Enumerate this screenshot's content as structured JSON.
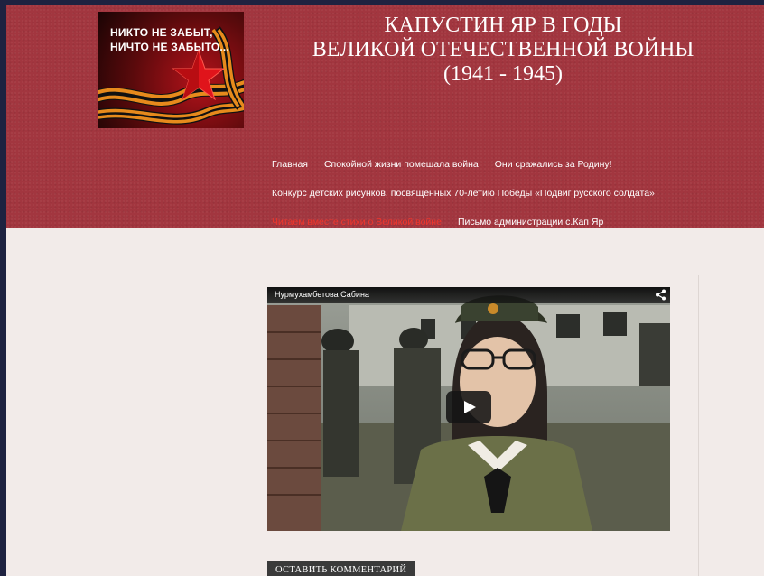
{
  "header": {
    "logo_text": "НИКТО НЕ ЗАБЫТ,\nНИЧТО НЕ ЗАБЫТО...",
    "title_lines": [
      "КАПУСТИН ЯР В ГОДЫ",
      "ВЕЛИКОЙ ОТЕЧЕСТВЕННОЙ ВОЙНЫ",
      "(1941 - 1945)"
    ]
  },
  "nav": {
    "rows": [
      [
        {
          "label": "Главная",
          "active": false
        },
        {
          "label": "Спокойной жизни помешала война",
          "active": false
        },
        {
          "label": "Они сражались за Родину!",
          "active": false
        }
      ],
      [
        {
          "label": "Конкурс детских рисунков, посвященных 70-летию Победы «Подвиг русского солдата»",
          "active": false
        }
      ],
      [
        {
          "label": "Читаем вместе стихи о Великой войне",
          "active": true
        },
        {
          "label": "Письмо администрации с.Кап Яр",
          "active": false
        }
      ]
    ]
  },
  "video": {
    "title": "Нурмухамбетова Сабина",
    "share_icon": "share-icon",
    "play_icon": "play-icon"
  },
  "comment_button": "ОСТАВИТЬ КОММЕНТАРИЙ",
  "colors": {
    "header_bg": "#a2363f",
    "page_bg": "#f2ebe9",
    "outer_bg": "#1e2240",
    "nav_active": "#f0352b",
    "button_bg": "#3a3a3a"
  }
}
